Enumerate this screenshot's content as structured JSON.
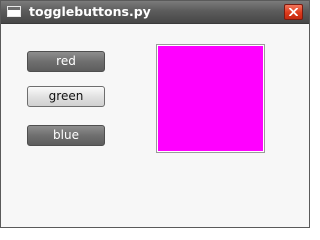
{
  "window": {
    "title": "togglebuttons.py",
    "icons": {
      "app": "window-icon",
      "close": "close-icon"
    }
  },
  "buttons": [
    {
      "label": "red",
      "active": true
    },
    {
      "label": "green",
      "active": false
    },
    {
      "label": "blue",
      "active": true
    }
  ],
  "swatch": {
    "color": "#ff00ff"
  }
}
